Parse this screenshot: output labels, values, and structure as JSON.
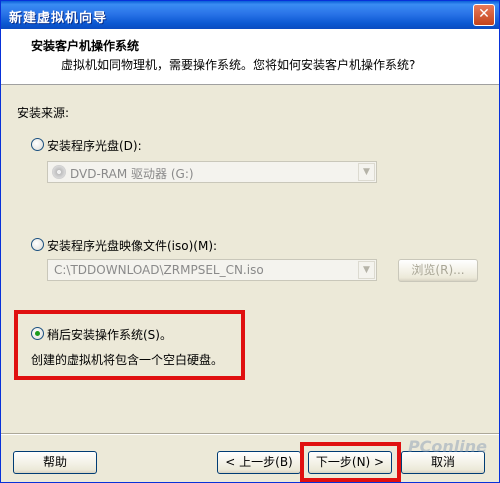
{
  "window": {
    "title": "新建虚拟机向导",
    "close_label": "✕"
  },
  "header": {
    "title": "安装客户机操作系统",
    "subtitle": "虚拟机如同物理机，需要操作系统。您将如何安装客户机操作系统?"
  },
  "source": {
    "label": "安装来源:",
    "options": [
      {
        "label": "安装程序光盘(D):",
        "checked": false,
        "select_value": "DVD-RAM 驱动器 (G:)"
      },
      {
        "label": "安装程序光盘映像文件(iso)(M):",
        "checked": false,
        "select_value": "C:\\TDDOWNLOAD\\ZRMPSEL_CN.iso",
        "browse_label": "浏览(R)..."
      },
      {
        "label": "稍后安装操作系统(S)。",
        "checked": true,
        "description": "创建的虚拟机将包含一个空白硬盘。"
      }
    ]
  },
  "footer": {
    "help_label": "帮助",
    "back_label": "< 上一步(B)",
    "next_label": "下一步(N) >",
    "cancel_label": "取消"
  },
  "watermark": "PConline",
  "colors": {
    "highlight": "#e01010",
    "titlebar": "#0a5fd8",
    "radio_dot": "#1b9b1b"
  }
}
